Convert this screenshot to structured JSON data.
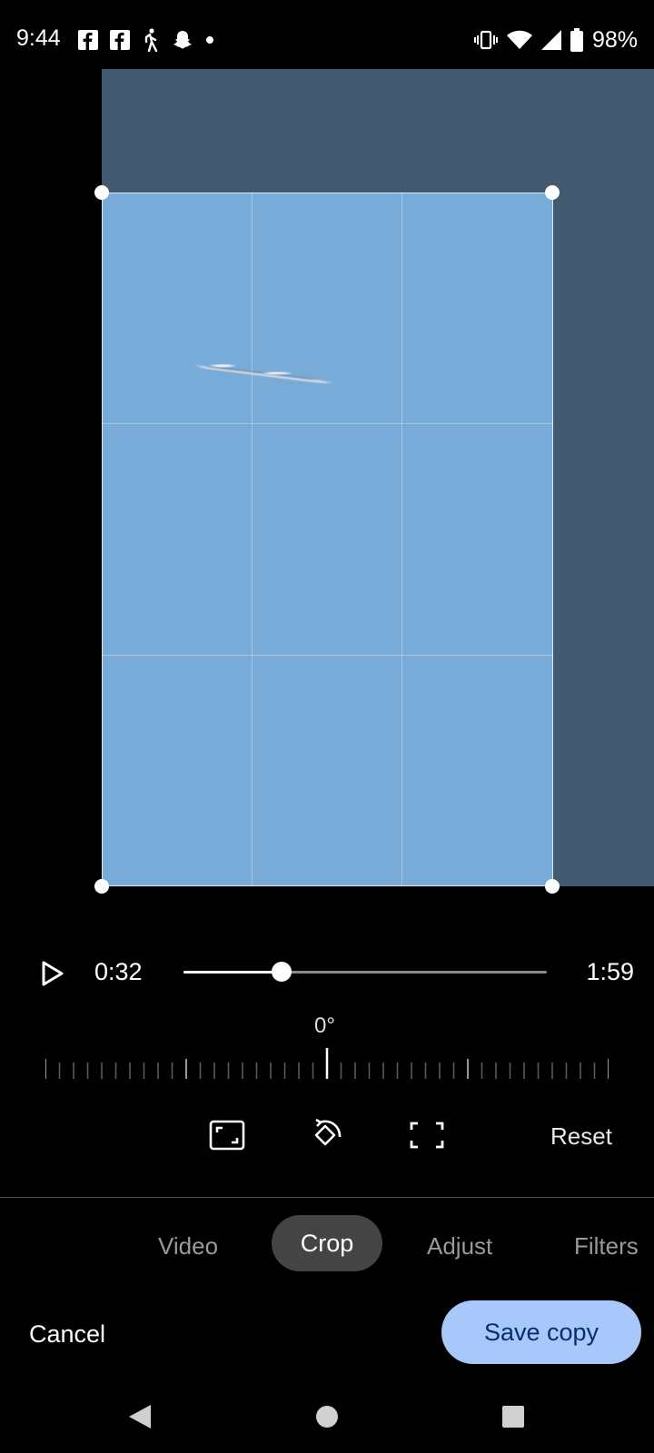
{
  "status_bar": {
    "time": "9:44",
    "left_icons": [
      "facebook-icon",
      "facebook-icon",
      "walking-icon",
      "snapchat-icon",
      "dot-icon"
    ],
    "right_icons": [
      "vibrate-icon",
      "wifi-icon",
      "signal-icon",
      "battery-icon"
    ],
    "battery": "98%"
  },
  "player": {
    "current_time": "0:32",
    "total_time": "1:59",
    "progress": 0.27
  },
  "rotation": {
    "angle_label": "0°"
  },
  "tools": {
    "aspect_icon": "aspect-ratio-icon",
    "rotate_icon": "rotate-icon",
    "free_crop_icon": "crop-free-icon",
    "reset_label": "Reset"
  },
  "tabs": {
    "items": [
      {
        "label": "Video"
      },
      {
        "label": "Crop"
      },
      {
        "label": "Adjust"
      },
      {
        "label": "Filters"
      }
    ],
    "active": "Crop"
  },
  "actions": {
    "cancel_label": "Cancel",
    "save_label": "Save copy"
  },
  "nav_bar": {
    "icons": [
      "back-icon",
      "home-icon",
      "recents-icon"
    ]
  },
  "colors": {
    "accent": "#a8c7fa",
    "accent_text": "#062e6f",
    "sky": "#79abd9",
    "photo_outside": "#415a71"
  }
}
